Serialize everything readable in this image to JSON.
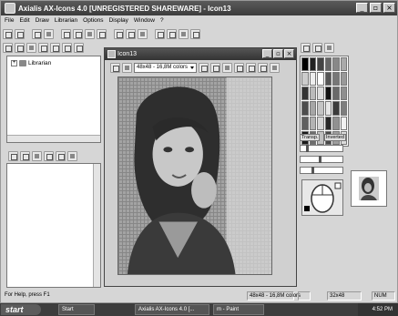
{
  "app": {
    "title": "Axialis AX-Icons 4.0 [UNREGISTERED SHAREWARE] - Icon13"
  },
  "menu": [
    "File",
    "Edit",
    "Draw",
    "Librarian",
    "Options",
    "Display",
    "Window",
    "?"
  ],
  "librarian": {
    "tree_item": "Librarian"
  },
  "icon_window": {
    "title": "Icon13",
    "format": "48x48 - 16,8M colors"
  },
  "palette": {
    "transp_label": "Transp.",
    "inverted_label": "Inverted"
  },
  "status": {
    "help": "For Help, press F1",
    "format": "48x48 - 16,8M colors",
    "size": "32x48",
    "num": "NUM"
  },
  "taskbar": {
    "start": "start",
    "tasks": [
      "Start",
      "Axialis AX-Icons 4.0 [...",
      "m - Paint"
    ],
    "clock": "4:52 PM"
  }
}
